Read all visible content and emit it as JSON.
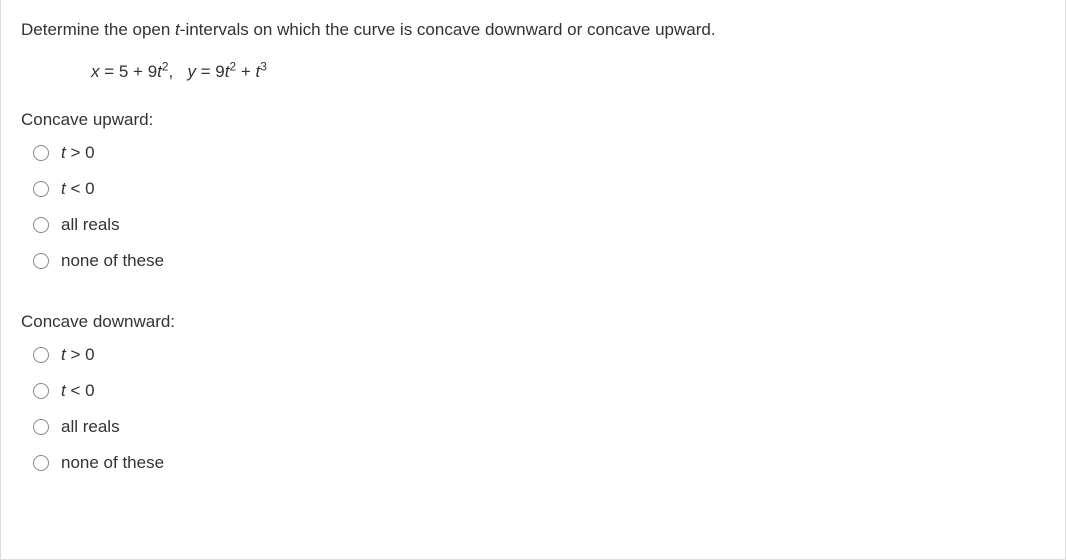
{
  "question": {
    "prompt_pre": "Determine the open ",
    "prompt_var": "t",
    "prompt_post": "-intervals on which the curve is concave downward or concave upward."
  },
  "equation": {
    "x_left": "x",
    "x_eq": " = 5 + 9",
    "x_var": "t",
    "y_left": "y",
    "y_eq": " = 9",
    "y_var": "t",
    "plus": " + ",
    "comma": ",   "
  },
  "sections": {
    "upward_label": "Concave upward:",
    "downward_label": "Concave downward:"
  },
  "options": {
    "opt1_var": "t",
    "opt1_rest": " > 0",
    "opt2_var": "t",
    "opt2_rest": " < 0",
    "opt3": "all reals",
    "opt4": "none of these"
  }
}
